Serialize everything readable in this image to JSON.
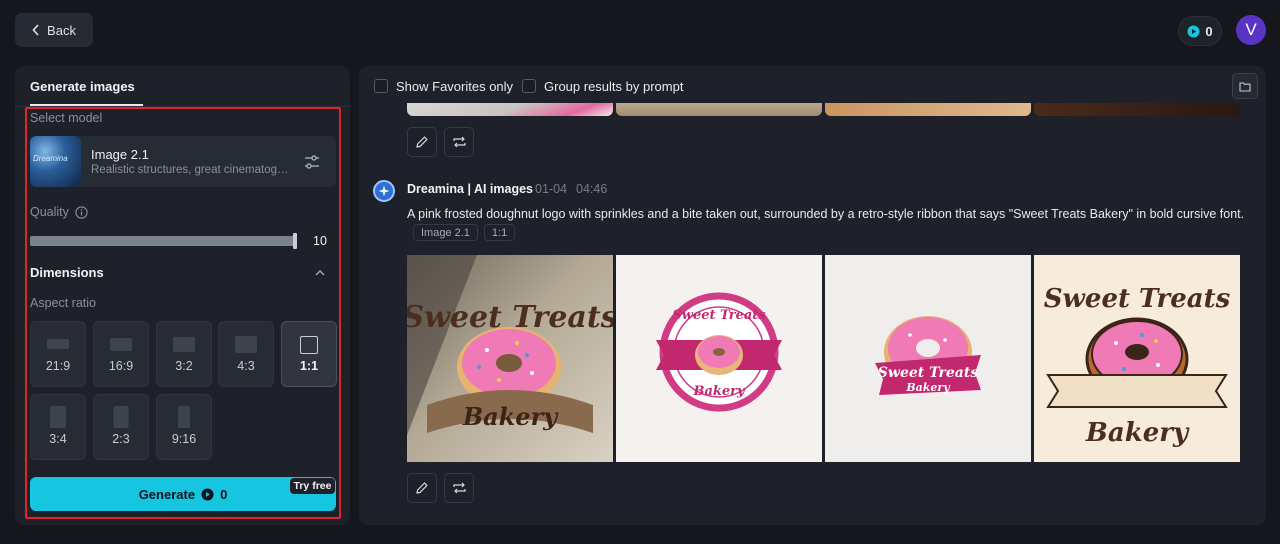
{
  "header": {
    "back_label": "Back",
    "credits": "0",
    "avatar_initial": "V"
  },
  "left_panel": {
    "tab_label": "Generate images",
    "select_model_label": "Select model",
    "model": {
      "name": "Image 2.1",
      "description": "Realistic structures, great cinematography",
      "thumb_text": "Dreamina"
    },
    "quality_label": "Quality",
    "quality_value": "10",
    "quality_fraction": 1.0,
    "dimensions_label": "Dimensions",
    "aspect_ratio_label": "Aspect ratio",
    "ratios": [
      {
        "label": "21:9",
        "selected": false
      },
      {
        "label": "16:9",
        "selected": false
      },
      {
        "label": "3:2",
        "selected": false
      },
      {
        "label": "4:3",
        "selected": false
      },
      {
        "label": "1:1",
        "selected": true
      },
      {
        "label": "3:4",
        "selected": false
      },
      {
        "label": "2:3",
        "selected": false
      },
      {
        "label": "9:16",
        "selected": false
      }
    ],
    "generate_label": "Generate",
    "generate_cost": "0",
    "try_free_label": "Try free"
  },
  "right_panel": {
    "show_favorites_label": "Show Favorites only",
    "group_by_prompt_label": "Group results by prompt",
    "result": {
      "author": "Dreamina | AI images",
      "date": "01-04",
      "time": "04:46",
      "prompt": "A pink frosted doughnut logo with sprinkles and a bite taken out, surrounded by a retro-style ribbon that says \"Sweet Treats Bakery\" in bold cursive font.",
      "model_tag": "Image 2.1",
      "ratio_tag": "1:1",
      "image_texts": [
        "Sweet Treats",
        "Bakery"
      ]
    }
  },
  "colors": {
    "accent": "#16c6e0",
    "highlight": "#e0242a",
    "avatar": "#5a34c4",
    "donut_pink": "#f07ab5",
    "ribbon_magenta": "#c2286e",
    "brown": "#4b2e1e"
  }
}
